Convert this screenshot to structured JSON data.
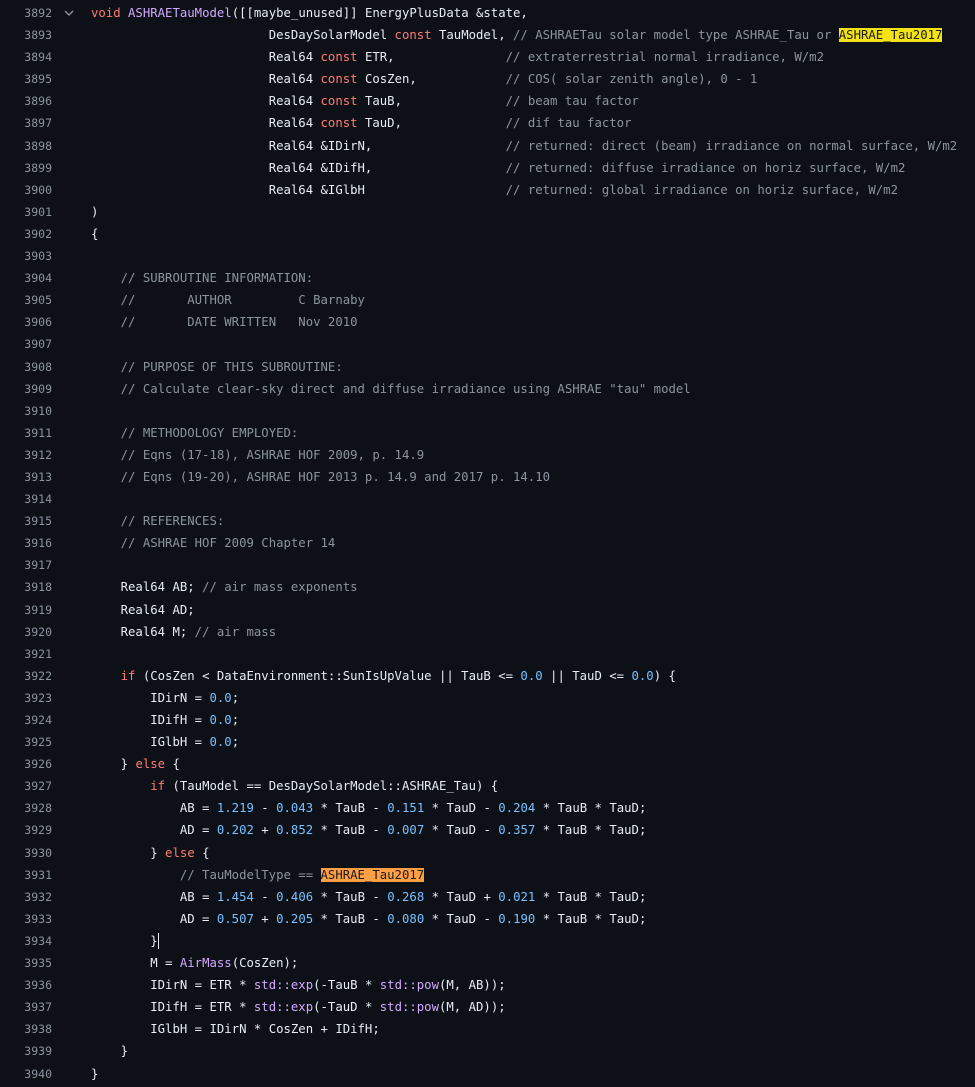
{
  "editor": {
    "lines": [
      {
        "n": "3892",
        "fold": true,
        "ind": "",
        "tokens": [
          {
            "t": "kw",
            "v": "void "
          },
          {
            "t": "fn",
            "v": "ASHRAETauModel"
          },
          {
            "t": "plain",
            "v": "([[maybe_unused]] EnergyPlusData &state,"
          }
        ]
      },
      {
        "n": "3893",
        "ind": "                        ",
        "tokens": [
          {
            "t": "plain",
            "v": "DesDaySolarModel "
          },
          {
            "t": "kw",
            "v": "const"
          },
          {
            "t": "plain",
            "v": " TauModel, "
          },
          {
            "t": "cm",
            "v": "// ASHRAETau solar model type ASHRAE_Tau or "
          },
          {
            "t": "hl-yellow",
            "v": "ASHRAE_Tau2017"
          }
        ]
      },
      {
        "n": "3894",
        "ind": "                        ",
        "tokens": [
          {
            "t": "plain",
            "v": "Real64 "
          },
          {
            "t": "kw",
            "v": "const"
          },
          {
            "t": "plain",
            "v": " ETR,               "
          },
          {
            "t": "cm",
            "v": "// extraterrestrial normal irradiance, W/m2"
          }
        ]
      },
      {
        "n": "3895",
        "ind": "                        ",
        "tokens": [
          {
            "t": "plain",
            "v": "Real64 "
          },
          {
            "t": "kw",
            "v": "const"
          },
          {
            "t": "plain",
            "v": " CosZen,            "
          },
          {
            "t": "cm",
            "v": "// COS( solar zenith angle), 0 - 1"
          }
        ]
      },
      {
        "n": "3896",
        "ind": "                        ",
        "tokens": [
          {
            "t": "plain",
            "v": "Real64 "
          },
          {
            "t": "kw",
            "v": "const"
          },
          {
            "t": "plain",
            "v": " TauB,              "
          },
          {
            "t": "cm",
            "v": "// beam tau factor"
          }
        ]
      },
      {
        "n": "3897",
        "ind": "                        ",
        "tokens": [
          {
            "t": "plain",
            "v": "Real64 "
          },
          {
            "t": "kw",
            "v": "const"
          },
          {
            "t": "plain",
            "v": " TauD,              "
          },
          {
            "t": "cm",
            "v": "// dif tau factor"
          }
        ]
      },
      {
        "n": "3898",
        "ind": "                        ",
        "tokens": [
          {
            "t": "plain",
            "v": "Real64 &IDirN,                  "
          },
          {
            "t": "cm",
            "v": "// returned: direct (beam) irradiance on normal surface, W/m2"
          }
        ]
      },
      {
        "n": "3899",
        "ind": "                        ",
        "tokens": [
          {
            "t": "plain",
            "v": "Real64 &IDifH,                  "
          },
          {
            "t": "cm",
            "v": "// returned: diffuse irradiance on horiz surface, W/m2"
          }
        ]
      },
      {
        "n": "3900",
        "ind": "                        ",
        "tokens": [
          {
            "t": "plain",
            "v": "Real64 &IGlbH                   "
          },
          {
            "t": "cm",
            "v": "// returned: global irradiance on horiz surface, W/m2"
          }
        ]
      },
      {
        "n": "3901",
        "ind": "",
        "tokens": [
          {
            "t": "plain",
            "v": ")"
          }
        ]
      },
      {
        "n": "3902",
        "ind": "",
        "tokens": [
          {
            "t": "plain",
            "v": "{"
          }
        ]
      },
      {
        "n": "3903",
        "ind": "",
        "tokens": []
      },
      {
        "n": "3904",
        "ind": "    ",
        "tokens": [
          {
            "t": "cm",
            "v": "// SUBROUTINE INFORMATION:"
          }
        ]
      },
      {
        "n": "3905",
        "ind": "    ",
        "tokens": [
          {
            "t": "cm",
            "v": "//       AUTHOR         C Barnaby"
          }
        ]
      },
      {
        "n": "3906",
        "ind": "    ",
        "tokens": [
          {
            "t": "cm",
            "v": "//       DATE WRITTEN   Nov 2010"
          }
        ]
      },
      {
        "n": "3907",
        "ind": "",
        "tokens": []
      },
      {
        "n": "3908",
        "ind": "    ",
        "tokens": [
          {
            "t": "cm",
            "v": "// PURPOSE OF THIS SUBROUTINE:"
          }
        ]
      },
      {
        "n": "3909",
        "ind": "    ",
        "tokens": [
          {
            "t": "cm",
            "v": "// Calculate clear-sky direct and diffuse irradiance using ASHRAE \"tau\" model"
          }
        ]
      },
      {
        "n": "3910",
        "ind": "",
        "tokens": []
      },
      {
        "n": "3911",
        "ind": "    ",
        "tokens": [
          {
            "t": "cm",
            "v": "// METHODOLOGY EMPLOYED:"
          }
        ]
      },
      {
        "n": "3912",
        "ind": "    ",
        "tokens": [
          {
            "t": "cm",
            "v": "// Eqns (17-18), ASHRAE HOF 2009, p. 14.9"
          }
        ]
      },
      {
        "n": "3913",
        "ind": "    ",
        "tokens": [
          {
            "t": "cm",
            "v": "// Eqns (19-20), ASHRAE HOF 2013 p. 14.9 and 2017 p. 14.10"
          }
        ]
      },
      {
        "n": "3914",
        "ind": "",
        "tokens": []
      },
      {
        "n": "3915",
        "ind": "    ",
        "tokens": [
          {
            "t": "cm",
            "v": "// REFERENCES:"
          }
        ]
      },
      {
        "n": "3916",
        "ind": "    ",
        "tokens": [
          {
            "t": "cm",
            "v": "// ASHRAE HOF 2009 Chapter 14"
          }
        ]
      },
      {
        "n": "3917",
        "ind": "",
        "tokens": []
      },
      {
        "n": "3918",
        "ind": "    ",
        "tokens": [
          {
            "t": "plain",
            "v": "Real64 AB; "
          },
          {
            "t": "cm",
            "v": "// air mass exponents"
          }
        ]
      },
      {
        "n": "3919",
        "ind": "    ",
        "tokens": [
          {
            "t": "plain",
            "v": "Real64 AD;"
          }
        ]
      },
      {
        "n": "3920",
        "ind": "    ",
        "tokens": [
          {
            "t": "plain",
            "v": "Real64 M; "
          },
          {
            "t": "cm",
            "v": "// air mass"
          }
        ]
      },
      {
        "n": "3921",
        "ind": "",
        "tokens": []
      },
      {
        "n": "3922",
        "ind": "    ",
        "tokens": [
          {
            "t": "kw",
            "v": "if"
          },
          {
            "t": "plain",
            "v": " (CosZen < DataEnvironment::SunIsUpValue || TauB <= "
          },
          {
            "t": "num",
            "v": "0.0"
          },
          {
            "t": "plain",
            "v": " || TauD <= "
          },
          {
            "t": "num",
            "v": "0.0"
          },
          {
            "t": "plain",
            "v": ") {"
          }
        ]
      },
      {
        "n": "3923",
        "ind": "        ",
        "tokens": [
          {
            "t": "plain",
            "v": "IDirN = "
          },
          {
            "t": "num",
            "v": "0.0"
          },
          {
            "t": "plain",
            "v": ";"
          }
        ]
      },
      {
        "n": "3924",
        "ind": "        ",
        "tokens": [
          {
            "t": "plain",
            "v": "IDifH = "
          },
          {
            "t": "num",
            "v": "0.0"
          },
          {
            "t": "plain",
            "v": ";"
          }
        ]
      },
      {
        "n": "3925",
        "ind": "        ",
        "tokens": [
          {
            "t": "plain",
            "v": "IGlbH = "
          },
          {
            "t": "num",
            "v": "0.0"
          },
          {
            "t": "plain",
            "v": ";"
          }
        ]
      },
      {
        "n": "3926",
        "ind": "    ",
        "tokens": [
          {
            "t": "plain",
            "v": "} "
          },
          {
            "t": "kw",
            "v": "else"
          },
          {
            "t": "plain",
            "v": " {"
          }
        ]
      },
      {
        "n": "3927",
        "ind": "        ",
        "tokens": [
          {
            "t": "kw",
            "v": "if"
          },
          {
            "t": "plain",
            "v": " (TauModel == DesDaySolarModel::ASHRAE_Tau) {"
          }
        ]
      },
      {
        "n": "3928",
        "ind": "            ",
        "tokens": [
          {
            "t": "plain",
            "v": "AB = "
          },
          {
            "t": "num",
            "v": "1.219"
          },
          {
            "t": "plain",
            "v": " - "
          },
          {
            "t": "num",
            "v": "0.043"
          },
          {
            "t": "plain",
            "v": " * TauB - "
          },
          {
            "t": "num",
            "v": "0.151"
          },
          {
            "t": "plain",
            "v": " * TauD - "
          },
          {
            "t": "num",
            "v": "0.204"
          },
          {
            "t": "plain",
            "v": " * TauB * TauD;"
          }
        ]
      },
      {
        "n": "3929",
        "ind": "            ",
        "tokens": [
          {
            "t": "plain",
            "v": "AD = "
          },
          {
            "t": "num",
            "v": "0.202"
          },
          {
            "t": "plain",
            "v": " + "
          },
          {
            "t": "num",
            "v": "0.852"
          },
          {
            "t": "plain",
            "v": " * TauB - "
          },
          {
            "t": "num",
            "v": "0.007"
          },
          {
            "t": "plain",
            "v": " * TauD - "
          },
          {
            "t": "num",
            "v": "0.357"
          },
          {
            "t": "plain",
            "v": " * TauB * TauD;"
          }
        ]
      },
      {
        "n": "3930",
        "ind": "        ",
        "tokens": [
          {
            "t": "plain",
            "v": "} "
          },
          {
            "t": "kw",
            "v": "else"
          },
          {
            "t": "plain",
            "v": " {"
          }
        ]
      },
      {
        "n": "3931",
        "ind": "            ",
        "tokens": [
          {
            "t": "cm",
            "v": "// TauModelType == "
          },
          {
            "t": "hl-orange",
            "v": "ASHRAE_Tau2017"
          }
        ]
      },
      {
        "n": "3932",
        "ind": "            ",
        "tokens": [
          {
            "t": "plain",
            "v": "AB = "
          },
          {
            "t": "num",
            "v": "1.454"
          },
          {
            "t": "plain",
            "v": " - "
          },
          {
            "t": "num",
            "v": "0.406"
          },
          {
            "t": "plain",
            "v": " * TauB - "
          },
          {
            "t": "num",
            "v": "0.268"
          },
          {
            "t": "plain",
            "v": " * TauD + "
          },
          {
            "t": "num",
            "v": "0.021"
          },
          {
            "t": "plain",
            "v": " * TauB * TauD;"
          }
        ]
      },
      {
        "n": "3933",
        "ind": "            ",
        "tokens": [
          {
            "t": "plain",
            "v": "AD = "
          },
          {
            "t": "num",
            "v": "0.507"
          },
          {
            "t": "plain",
            "v": " + "
          },
          {
            "t": "num",
            "v": "0.205"
          },
          {
            "t": "plain",
            "v": " * TauB - "
          },
          {
            "t": "num",
            "v": "0.080"
          },
          {
            "t": "plain",
            "v": " * TauD - "
          },
          {
            "t": "num",
            "v": "0.190"
          },
          {
            "t": "plain",
            "v": " * TauB * TauD;"
          }
        ]
      },
      {
        "n": "3934",
        "ind": "        ",
        "cursor": true,
        "tokens": [
          {
            "t": "plain",
            "v": "}"
          }
        ]
      },
      {
        "n": "3935",
        "ind": "        ",
        "tokens": [
          {
            "t": "plain",
            "v": "M = "
          },
          {
            "t": "fn",
            "v": "AirMass"
          },
          {
            "t": "plain",
            "v": "(CosZen);"
          }
        ]
      },
      {
        "n": "3936",
        "ind": "        ",
        "tokens": [
          {
            "t": "plain",
            "v": "IDirN = ETR * "
          },
          {
            "t": "fn",
            "v": "std::exp"
          },
          {
            "t": "plain",
            "v": "(-TauB * "
          },
          {
            "t": "fn",
            "v": "std::pow"
          },
          {
            "t": "plain",
            "v": "(M, AB));"
          }
        ]
      },
      {
        "n": "3937",
        "ind": "        ",
        "tokens": [
          {
            "t": "plain",
            "v": "IDifH = ETR * "
          },
          {
            "t": "fn",
            "v": "std::exp"
          },
          {
            "t": "plain",
            "v": "(-TauD * "
          },
          {
            "t": "fn",
            "v": "std::pow"
          },
          {
            "t": "plain",
            "v": "(M, AD));"
          }
        ]
      },
      {
        "n": "3938",
        "ind": "        ",
        "tokens": [
          {
            "t": "plain",
            "v": "IGlbH = IDirN * CosZen + IDifH;"
          }
        ]
      },
      {
        "n": "3939",
        "ind": "    ",
        "tokens": [
          {
            "t": "plain",
            "v": "}"
          }
        ]
      },
      {
        "n": "3940",
        "ind": "",
        "tokens": [
          {
            "t": "plain",
            "v": "}"
          }
        ]
      }
    ]
  }
}
